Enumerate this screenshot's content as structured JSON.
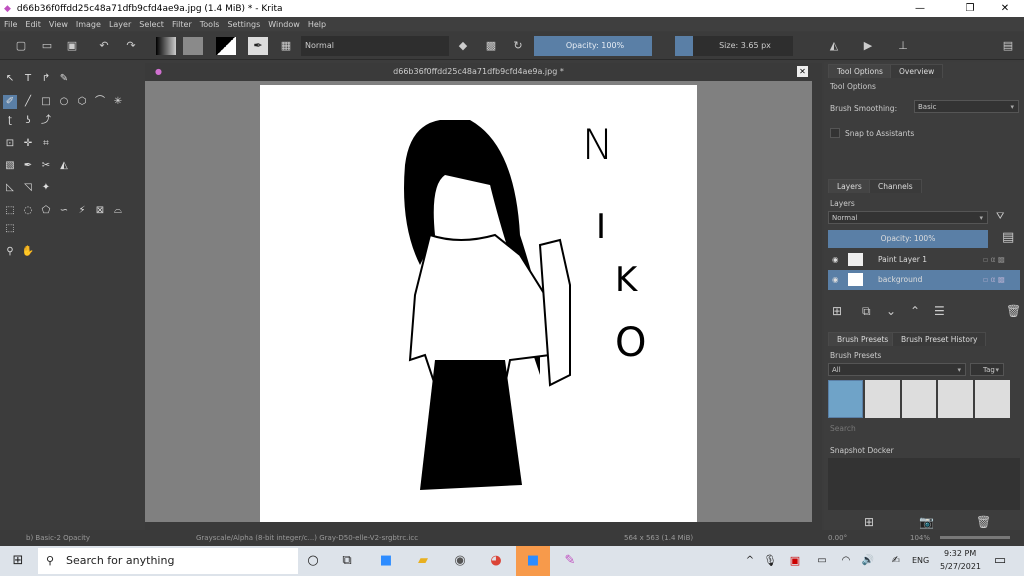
{
  "window": {
    "title": "d66b36f0ffdd25c48a71dfb9cfd4ae9a.jpg (1.4 MiB)  * - Krita",
    "minimize": "—",
    "maximize": "❐",
    "close": "✕"
  },
  "menu": [
    "File",
    "Edit",
    "View",
    "Image",
    "Layer",
    "Select",
    "Filter",
    "Tools",
    "Settings",
    "Window",
    "Help"
  ],
  "toolbar": {
    "blend_mode": "Normal",
    "opacity": "Opacity: 100%",
    "size": "Size: 3.65 px"
  },
  "document": {
    "tab_title": "d66b36f0ffdd25c48a71dfb9cfd4ae9a.jpg *",
    "artwork_letters": [
      "N",
      "I",
      "K",
      "O"
    ]
  },
  "tool_options": {
    "tabs": [
      "Tool Options",
      "Overview"
    ],
    "title": "Tool Options",
    "brush_smoothing_label": "Brush Smoothing:",
    "brush_smoothing_value": "Basic",
    "snap_label": "Snap to Assistants"
  },
  "layers": {
    "tabs": [
      "Layers",
      "Channels"
    ],
    "title": "Layers",
    "blend_mode": "Normal",
    "opacity": "Opacity:  100%",
    "items": [
      {
        "name": "Paint Layer 1",
        "selected": false
      },
      {
        "name": "background",
        "selected": true
      }
    ]
  },
  "brush_presets": {
    "tabs": [
      "Brush Presets",
      "Brush Preset History"
    ],
    "title": "Brush Presets",
    "filter": "All",
    "tag": "Tag",
    "search_placeholder": "Search"
  },
  "snapshot": {
    "title": "Snapshot Docker"
  },
  "statusbar": {
    "preset": "b) Basic-2 Opacity",
    "color_space": "Grayscale/Alpha (8-bit integer/c...) Gray-D50-elle-V2-srgbtrc.icc",
    "image_size": "564 x 563 (1.4 MiB)",
    "rotation": "0.00°",
    "zoom": "104%"
  },
  "taskbar": {
    "search_placeholder": "Search for anything",
    "language": "ENG",
    "time": "9:32 PM",
    "date": "5/27/2021"
  },
  "colors": {
    "accent": "#5a7fa6",
    "panel": "#3c3c3c",
    "canvas_bg": "#808080"
  }
}
